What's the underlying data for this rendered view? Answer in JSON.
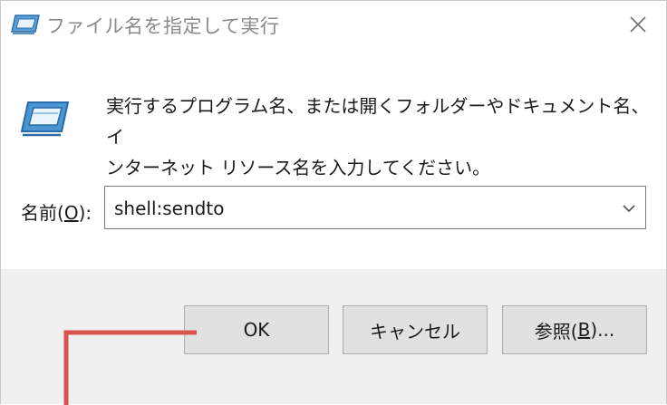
{
  "window": {
    "title": "ファイル名を指定して実行"
  },
  "description": {
    "line1": "実行するプログラム名、または開くフォルダーやドキュメント名、イ",
    "line2": "ンターネット リソース名を入力してください。"
  },
  "name_field": {
    "label_prefix": "名前(",
    "label_accesskey": "O",
    "label_suffix": "):",
    "value": "shell:sendto"
  },
  "buttons": {
    "ok": "OK",
    "cancel": "キャンセル",
    "browse_prefix": "参照(",
    "browse_accesskey": "B",
    "browse_suffix": ")..."
  },
  "icons": {
    "title": "run-icon",
    "close": "close-icon",
    "large": "run-icon",
    "dropdown": "chevron-down-icon"
  },
  "colors": {
    "annotation": "#d9534f",
    "footer_bg": "#f0f0f0",
    "button_bg": "#e1e1e1"
  }
}
